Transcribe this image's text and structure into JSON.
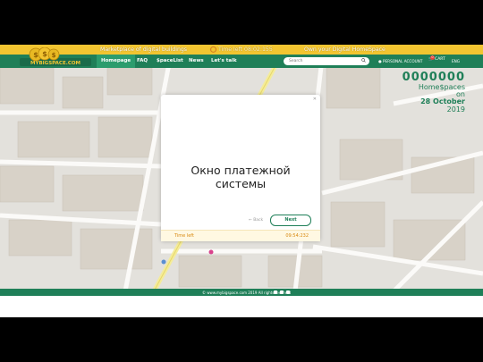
{
  "banner": {
    "left": "Marketplace of digital buildings",
    "timer": "Time left 08:02:155",
    "right": "Own your Digital HomeSpace"
  },
  "logo": {
    "text": "MYBIGSPACE.COM"
  },
  "nav": {
    "items": [
      "Homepage",
      "FAQ",
      "$paceList",
      "News",
      "Let's talk"
    ],
    "search_placeholder": "Search",
    "account": "PERSONAL ACCOUNT",
    "cart": "CART",
    "cart_count": "0",
    "language": "ENG"
  },
  "counter": {
    "number": "0000000",
    "label": "Home$paces",
    "on": "on",
    "date": "28 October",
    "year": "2019"
  },
  "modal": {
    "message": "Окно платежной\nсистемы",
    "back": "← Back",
    "next": "Next",
    "time_left_label": "Time left",
    "time_left_value": "09:54:232"
  },
  "footer": {
    "copyright": "© www.mybigspace.com 2019 All rights reserved"
  },
  "colors": {
    "green": "#1f7f58",
    "gold": "#f2c531",
    "orange": "#d88a12"
  }
}
